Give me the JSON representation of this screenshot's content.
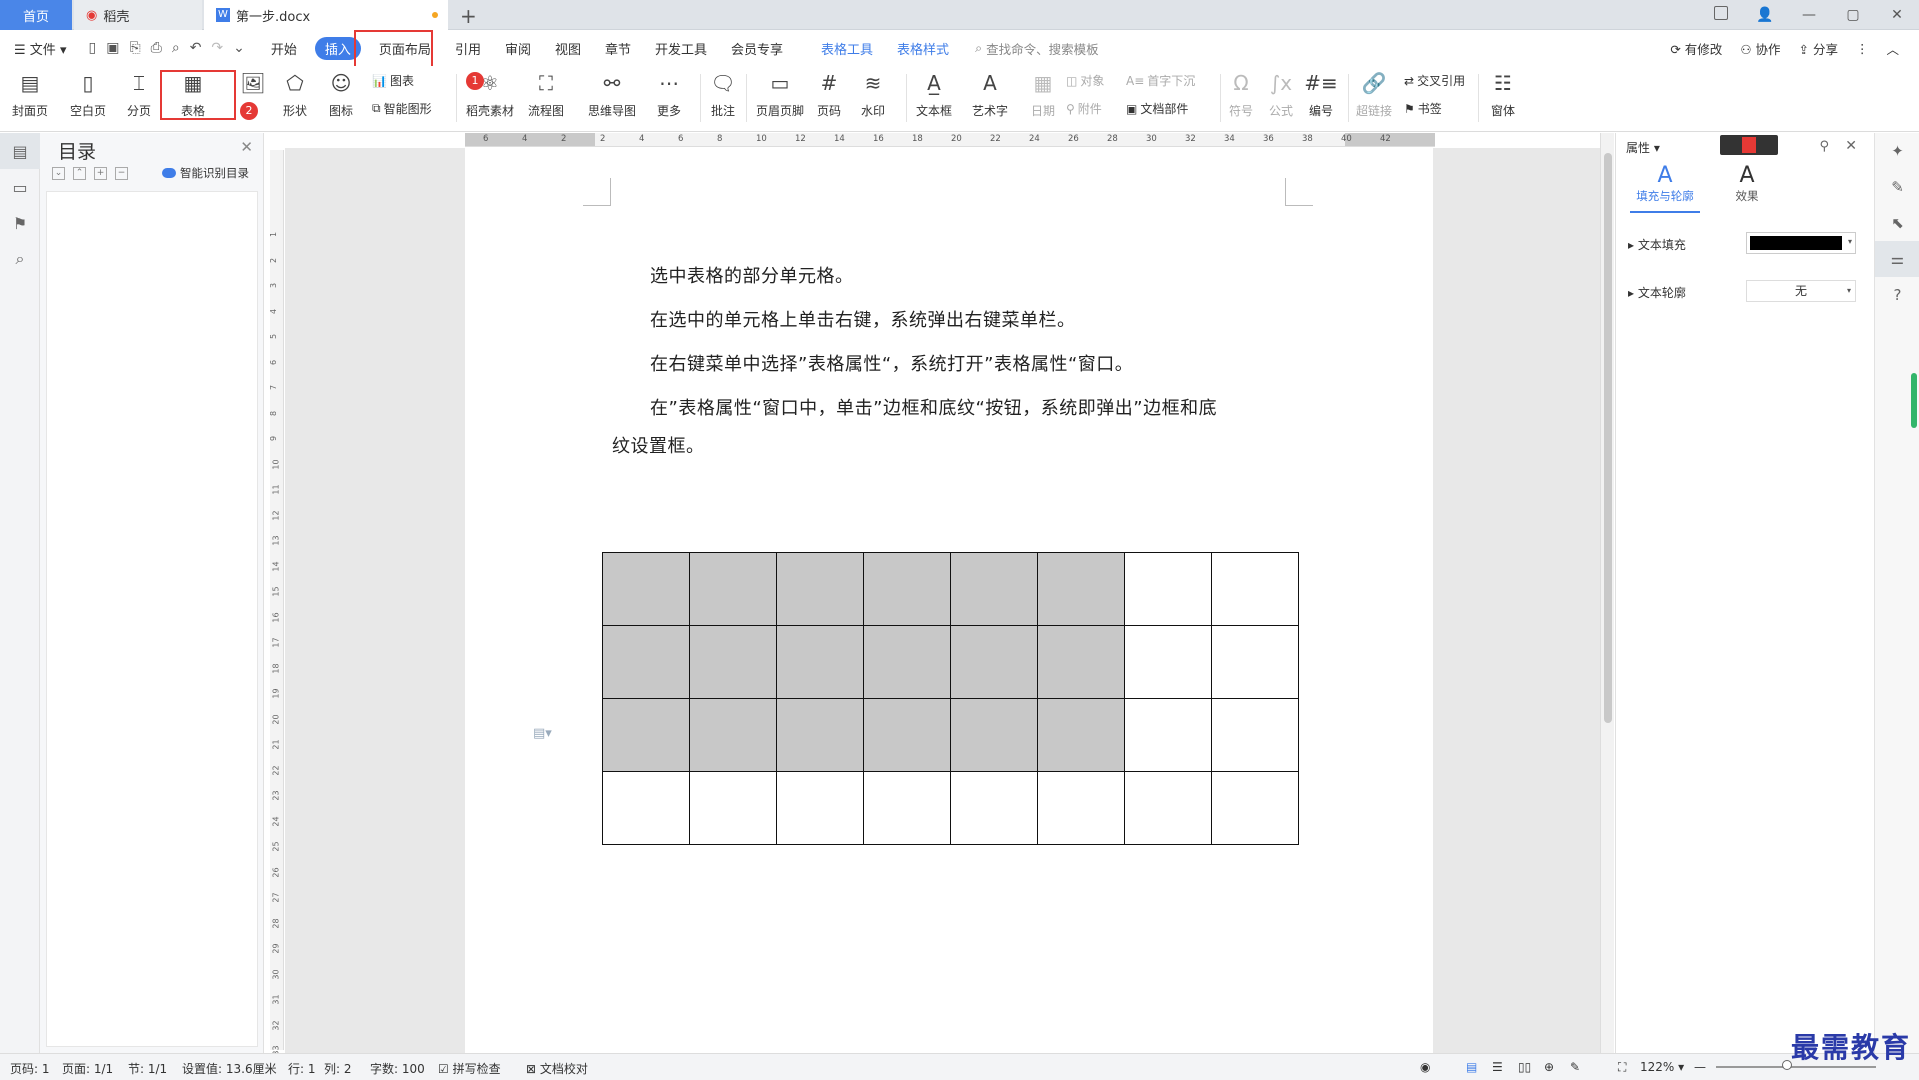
{
  "tabs": {
    "home": "首页",
    "daoke": "稻壳",
    "doc": "第一步.docx",
    "new_tab": "+"
  },
  "menubar": {
    "file": "文件",
    "items": [
      "开始",
      "插入",
      "页面布局",
      "引用",
      "审阅",
      "视图",
      "章节",
      "开发工具",
      "会员专享"
    ],
    "context": [
      "表格工具",
      "表格样式"
    ],
    "search": "查找命令、搜索模板",
    "right": [
      "有修改",
      "协作",
      "分享"
    ]
  },
  "ribbon": {
    "cover": "封面页",
    "blank": "空白页",
    "pagebreak": "分页",
    "table": "表格",
    "picture_arrow": "▾",
    "shape": "形状",
    "iconlib": "图标",
    "chart": "图表",
    "smart": "智能图形",
    "daoke_material": "稻壳素材",
    "flow": "流程图",
    "mindmap": "思维导图",
    "more": "更多",
    "comment": "批注",
    "header_footer": "页眉页脚",
    "page_number": "页码",
    "watermark": "水印",
    "textbox": "文本框",
    "wordart": "艺术字",
    "date": "日期",
    "object": "对象",
    "attachment": "附件",
    "dropcap": "首字下沉",
    "docpart": "文档部件",
    "symbol": "符号",
    "formula": "公式",
    "numbering": "编号",
    "hyperlink": "超链接",
    "crossref": "交叉引用",
    "bookmark": "书签",
    "form": "窗体",
    "badge1": "1",
    "badge2": "2"
  },
  "toc": {
    "title": "目录",
    "ai": "智能识别目录"
  },
  "hruler_ticks": [
    "6",
    "4",
    "2",
    "2",
    "4",
    "6",
    "8",
    "10",
    "12",
    "14",
    "16",
    "18",
    "20",
    "22",
    "24",
    "26",
    "28",
    "30",
    "32",
    "34",
    "36",
    "38",
    "40",
    "42"
  ],
  "vruler_ticks": [
    "1",
    "2",
    "3",
    "4",
    "5",
    "6",
    "7",
    "8",
    "9",
    "10",
    "11",
    "12",
    "13",
    "14",
    "15",
    "16",
    "17",
    "18",
    "19",
    "20",
    "21",
    "22",
    "23",
    "24",
    "25",
    "26",
    "27",
    "28",
    "29",
    "30",
    "31",
    "32",
    "33"
  ],
  "document": {
    "p1": "选中表格的部分单元格。",
    "p2": "在选中的单元格上单击右键，系统弹出右键菜单栏。",
    "p3": "在右键菜单中选择”表格属性“，系统打开”表格属性“窗口。",
    "p4a": "在”表格属性“窗口中，单击”边框和底纹“按钮，系统即弹出”边框和底",
    "p4b": "纹设置框。",
    "table": {
      "rows": 4,
      "cols": 8,
      "shaded_rows": 3,
      "shaded_cols": 6,
      "shade_color": "#c8c8c8"
    }
  },
  "props": {
    "title": "属性",
    "tab_fill": "填充与轮廓",
    "tab_effect": "效果",
    "text_fill": "文本填充",
    "text_outline": "文本轮廓",
    "outline_value": "无",
    "fill_color": "#000000"
  },
  "status": {
    "page": "页码: 1",
    "pages": "页面: 1/1",
    "section": "节: 1/1",
    "setting": "设置值: 13.6厘米",
    "row": "行: 1",
    "col": "列: 2",
    "words": "字数: 100",
    "spell": "拼写检查",
    "proof": "文档校对",
    "zoom": "122%"
  },
  "watermark_text": "最需教育",
  "colors": {
    "accent": "#3f7de8",
    "highlight": "#e53935",
    "home_tab": "#4a86e8"
  }
}
